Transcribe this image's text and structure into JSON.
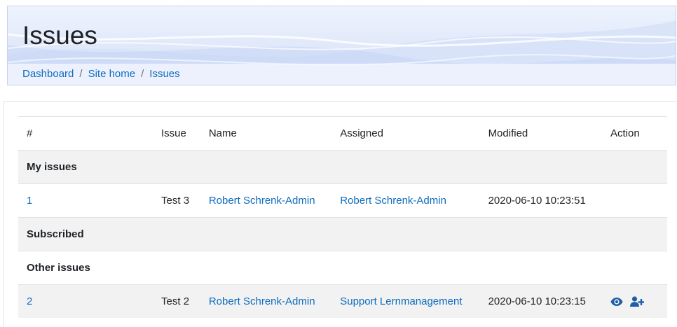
{
  "page": {
    "title": "Issues"
  },
  "breadcrumb": [
    {
      "label": "Dashboard"
    },
    {
      "label": "Site home"
    },
    {
      "label": "Issues"
    }
  ],
  "breadcrumb_separator": "/",
  "table": {
    "headers": {
      "num": "#",
      "issue": "Issue",
      "name": "Name",
      "assigned": "Assigned",
      "modified": "Modified",
      "action": "Action"
    },
    "groups": {
      "my_issues": "My issues",
      "subscribed": "Subscribed",
      "other_issues": "Other issues"
    },
    "rows": [
      {
        "num": "1",
        "issue": "Test 3",
        "name": "Robert Schrenk-Admin",
        "assigned": "Robert Schrenk-Admin",
        "modified": "2020-06-10 10:23:51",
        "actions": []
      },
      {
        "num": "2",
        "issue": "Test 2",
        "name": "Robert Schrenk-Admin",
        "assigned": "Support Lernmanagement",
        "modified": "2020-06-10 10:23:15",
        "actions": [
          "eye-icon",
          "user-plus-icon"
        ]
      }
    ]
  },
  "colors": {
    "link": "#0f6cbf",
    "icon": "#1f5da8",
    "shade": "#f2f2f2",
    "text": "#1d2125"
  }
}
